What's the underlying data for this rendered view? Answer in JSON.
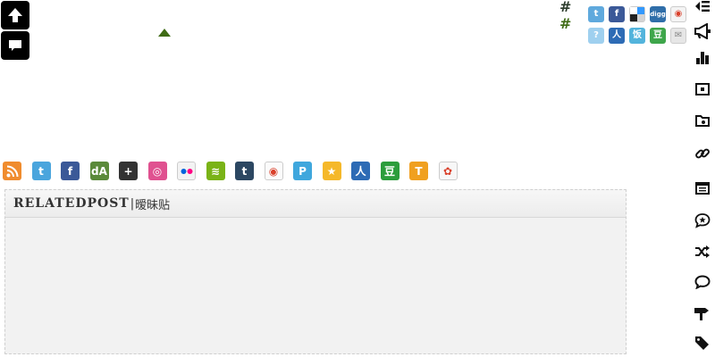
{
  "fabs": [
    {
      "name": "back-to-top-button",
      "icon": "arrow-up-icon"
    },
    {
      "name": "comment-button",
      "icon": "comment-icon"
    }
  ],
  "hashes": [
    {
      "text": "#",
      "color": "#2b3b2b"
    },
    {
      "text": "#",
      "color": "#3f6b15"
    }
  ],
  "share_row1": [
    {
      "name": "share-twitter",
      "icon": "twitter-icon",
      "glyph": "t",
      "color": "#5fa9dd"
    },
    {
      "name": "share-facebook",
      "icon": "facebook-icon",
      "glyph": "f",
      "color": "#3b5998"
    },
    {
      "name": "share-delicious",
      "icon": "delicious-icon",
      "glyph": "",
      "color": "#ffffff"
    },
    {
      "name": "share-digg",
      "icon": "digg-icon",
      "glyph": "digg",
      "color": "#2f6ea9"
    },
    {
      "name": "share-weibo",
      "icon": "weibo-icon",
      "glyph": "◉",
      "color": "#f4f4f4"
    }
  ],
  "share_row2": [
    {
      "name": "share-help",
      "icon": "question-icon",
      "glyph": "?",
      "color": "#9fd0ef"
    },
    {
      "name": "share-renren",
      "icon": "renren-icon",
      "glyph": "人",
      "color": "#2d6bb5"
    },
    {
      "name": "share-fanfou",
      "icon": "fanfou-icon",
      "glyph": "饭",
      "color": "#53b4dc"
    },
    {
      "name": "share-douban",
      "icon": "douban-icon",
      "glyph": "豆",
      "color": "#3ea64b"
    },
    {
      "name": "share-email",
      "icon": "mail-icon",
      "glyph": "✉",
      "color": "#e6e6e6"
    }
  ],
  "rail": [
    {
      "name": "rail-collapse",
      "icon": "collapse-menu-icon"
    },
    {
      "name": "rail-announcement",
      "icon": "megaphone-icon"
    },
    {
      "name": "rail-stats",
      "icon": "bar-chart-icon"
    },
    {
      "name": "rail-layout",
      "icon": "window-icon"
    },
    {
      "name": "rail-archive",
      "icon": "folder-icon"
    },
    {
      "name": "rail-links",
      "icon": "link-icon"
    },
    {
      "name": "rail-calendar",
      "icon": "calendar-icon"
    },
    {
      "name": "rail-featured",
      "icon": "star-comment-icon"
    },
    {
      "name": "rail-random",
      "icon": "shuffle-icon"
    },
    {
      "name": "rail-comments",
      "icon": "speech-bubble-icon"
    },
    {
      "name": "rail-signpost",
      "icon": "signpost-icon"
    },
    {
      "name": "rail-tags",
      "icon": "tag-icon"
    }
  ],
  "social": [
    {
      "name": "social-rss",
      "icon": "rss-icon",
      "glyph": "",
      "color": "#f08c2e"
    },
    {
      "name": "social-twitter",
      "icon": "twitter-icon",
      "glyph": "t",
      "color": "#4aa5dd"
    },
    {
      "name": "social-facebook",
      "icon": "facebook-icon",
      "glyph": "f",
      "color": "#3b5998"
    },
    {
      "name": "social-deviantart",
      "icon": "deviantart-icon",
      "glyph": "dA",
      "color": "#5b8a3a"
    },
    {
      "name": "social-googleplus",
      "icon": "google-plus-icon",
      "glyph": "+",
      "color": "#333333"
    },
    {
      "name": "social-dribbble",
      "icon": "dribbble-icon",
      "glyph": "◎",
      "color": "#e05190"
    },
    {
      "name": "social-flickr",
      "icon": "flickr-icon",
      "glyph": "",
      "color": "#f3f3f3"
    },
    {
      "name": "social-spotify",
      "icon": "spotify-icon",
      "glyph": "≋",
      "color": "#7ab317"
    },
    {
      "name": "social-tumblr",
      "icon": "tumblr-icon",
      "glyph": "t",
      "color": "#2c4762"
    },
    {
      "name": "social-weibo",
      "icon": "weibo-icon",
      "glyph": "◉",
      "color": "#fbfbfb"
    },
    {
      "name": "social-pinterest",
      "icon": "pin-icon",
      "glyph": "P",
      "color": "#3fa7dd"
    },
    {
      "name": "social-qzone",
      "icon": "qzone-icon",
      "glyph": "★",
      "color": "#f5b82a"
    },
    {
      "name": "social-renren",
      "icon": "renren-icon",
      "glyph": "人",
      "color": "#2d6bb5"
    },
    {
      "name": "social-douban",
      "icon": "douban-icon",
      "glyph": "豆",
      "color": "#2c9d3c"
    },
    {
      "name": "social-tianya",
      "icon": "tianya-icon",
      "glyph": "T",
      "color": "#f0a020"
    },
    {
      "name": "social-xianguo",
      "icon": "xianguo-icon",
      "glyph": "✿",
      "color": "#f7f7f7"
    }
  ],
  "related": {
    "title": "RELATEDPOST",
    "separator": "|",
    "subtitle": "暧昧贴"
  }
}
